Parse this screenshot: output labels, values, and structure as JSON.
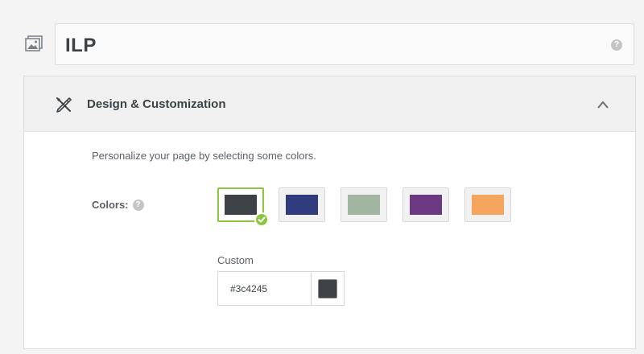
{
  "page": {
    "title": "ILP",
    "title_icon": "image-gallery-icon",
    "help_glyph": "?"
  },
  "panel": {
    "icon": "design-tools-icon",
    "title": "Design & Customization",
    "collapse_icon": "chevron-up-icon",
    "description": "Personalize your page by selecting some colors.",
    "colors_label": "Colors:",
    "swatches": [
      {
        "color": "#3c4245",
        "selected": true
      },
      {
        "color": "#313c7e",
        "selected": false
      },
      {
        "color": "#a1b5a1",
        "selected": false
      },
      {
        "color": "#6b3a82",
        "selected": false
      },
      {
        "color": "#f6a55e",
        "selected": false
      }
    ],
    "custom_label": "Custom",
    "custom_value": "#3c4245"
  },
  "colors": {
    "accent_selected": "#8cc63f",
    "text_dark": "#3c4245"
  }
}
